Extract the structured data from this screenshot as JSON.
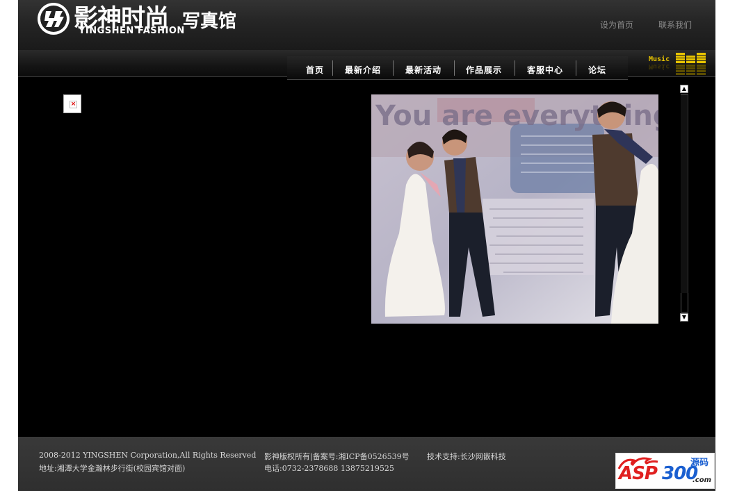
{
  "header": {
    "logo_cn": "影神时尚",
    "logo_en": "YINGSHEN FASHION",
    "studio": "写真馆",
    "links": {
      "homepage": "设为首页",
      "contact": "联系我们"
    }
  },
  "nav": {
    "items": [
      {
        "label": "首页"
      },
      {
        "label": "最新介绍"
      },
      {
        "label": "最新活动"
      },
      {
        "label": "作品展示"
      },
      {
        "label": "客服中心"
      },
      {
        "label": "论坛"
      }
    ]
  },
  "music": {
    "label": "Music"
  },
  "photo": {
    "headline": "You are everything to me"
  },
  "footer": {
    "copyright": "2008-2012 YINGSHEN Corporation,All Rights Reserved",
    "rights": "影神版权所有|备案号:湘ICP备0526539号",
    "support": "技术支持:长沙网嵌科技",
    "address": "地址:湘潭大学金瀚林步行街(校园宾馆对面)",
    "phone": "电话:0732-2378688 13875219525"
  },
  "badge": {
    "brand_red": "ASP",
    "brand_blue": "300",
    "cn": "源码",
    "domain": ".com"
  },
  "colors": {
    "background": "#000000",
    "footer": "#333333",
    "music": "#e8c400",
    "badge_red": "#e02020",
    "badge_blue": "#1a5fd0"
  }
}
